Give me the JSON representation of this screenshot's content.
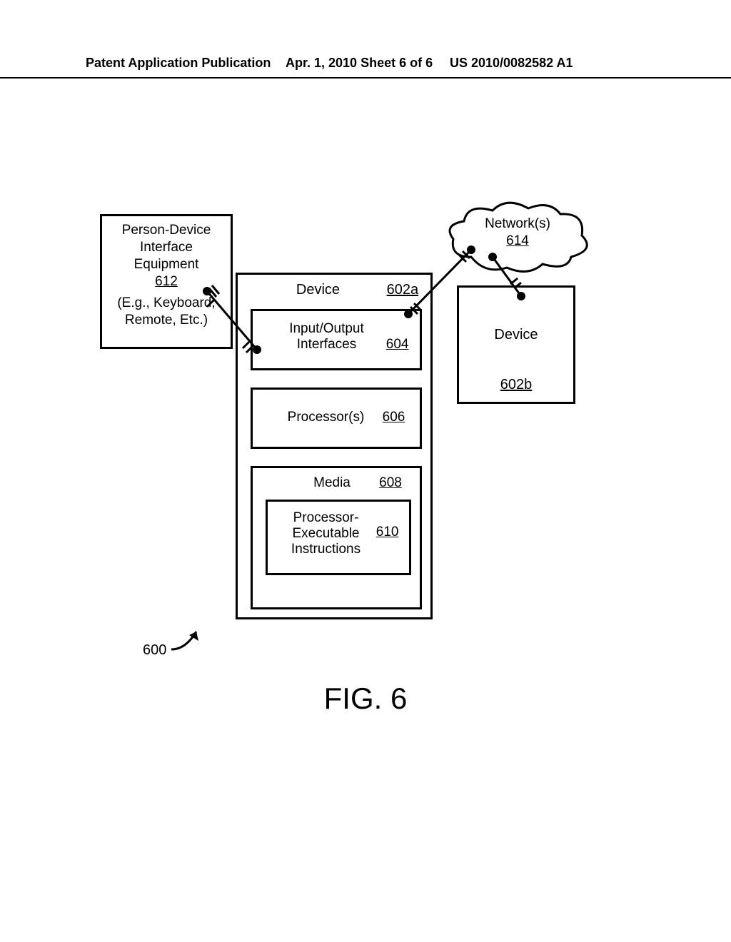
{
  "header": {
    "left": "Patent Application Publication",
    "center": "Apr. 1, 2010  Sheet 6 of 6",
    "right": "US 2010/0082582 A1"
  },
  "pdie": {
    "line1": "Person-Device",
    "line2": "Interface",
    "line3": "Equipment",
    "ref": "612",
    "note": "(E.g., Keyboard, Remote, Etc.)"
  },
  "device_a": {
    "label": "Device",
    "ref": "602a"
  },
  "io": {
    "label": "Input/Output Interfaces",
    "ref": "604"
  },
  "processors": {
    "label": "Processor(s)",
    "ref": "606"
  },
  "media": {
    "label": "Media",
    "ref": "608"
  },
  "instructions": {
    "label": "Processor-\nExecutable\nInstructions",
    "ref": "610"
  },
  "device_b": {
    "label": "Device",
    "ref": "602b"
  },
  "network": {
    "label": "Network(s)",
    "ref": "614"
  },
  "system_ref": "600",
  "figure_label": "FIG. 6"
}
